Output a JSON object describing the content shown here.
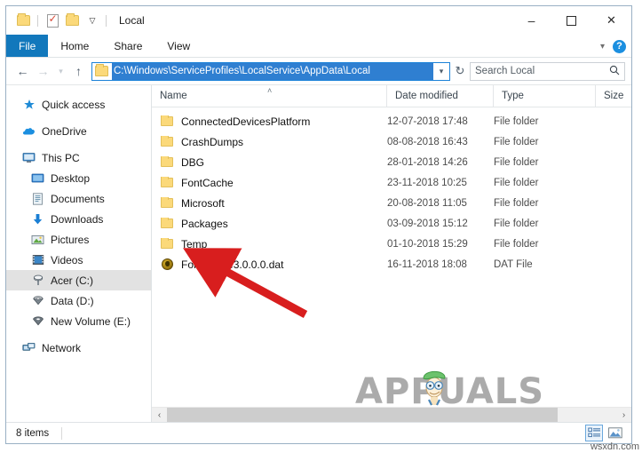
{
  "window": {
    "title": "Local",
    "quick_access": [
      "folder-icon",
      "properties-icon",
      "new-folder-icon",
      "customize-dropdown"
    ],
    "controls": {
      "minimize": "–",
      "maximize": "□",
      "close": "✕"
    }
  },
  "ribbon": {
    "tabs": [
      {
        "label": "File",
        "active": true
      },
      {
        "label": "Home",
        "active": false
      },
      {
        "label": "Share",
        "active": false
      },
      {
        "label": "View",
        "active": false
      }
    ],
    "collapse_icon": "chevron-down-icon",
    "help_icon": "?",
    "accent_color": "#1278bc"
  },
  "addressbar": {
    "back": "←",
    "forward": "→",
    "recent": "⌄",
    "up": "↑",
    "path": "C:\\Windows\\ServiceProfiles\\LocalService\\AppData\\Local",
    "dropdown": "⌄",
    "refresh": "↻",
    "selection_color": "#2f7fd1"
  },
  "search": {
    "placeholder": "Search Local",
    "icon": "search-icon"
  },
  "sidebar": {
    "items": [
      {
        "label": "Quick access",
        "icon": "star-icon",
        "indent": false,
        "gap": false,
        "selected": false
      },
      {
        "label": "OneDrive",
        "icon": "cloud-icon",
        "indent": false,
        "gap": true,
        "selected": false
      },
      {
        "label": "This PC",
        "icon": "monitor-icon",
        "indent": false,
        "gap": true,
        "selected": false
      },
      {
        "label": "Desktop",
        "icon": "desktop-icon",
        "indent": true,
        "gap": false,
        "selected": false
      },
      {
        "label": "Documents",
        "icon": "documents-icon",
        "indent": true,
        "gap": false,
        "selected": false
      },
      {
        "label": "Downloads",
        "icon": "download-icon",
        "indent": true,
        "gap": false,
        "selected": false
      },
      {
        "label": "Pictures",
        "icon": "pictures-icon",
        "indent": true,
        "gap": false,
        "selected": false
      },
      {
        "label": "Videos",
        "icon": "videos-icon",
        "indent": true,
        "gap": false,
        "selected": false
      },
      {
        "label": "Acer (C:)",
        "icon": "drive-icon",
        "indent": true,
        "gap": false,
        "selected": true
      },
      {
        "label": "Data (D:)",
        "icon": "drive-icon",
        "indent": true,
        "gap": false,
        "selected": false
      },
      {
        "label": "New Volume (E:)",
        "icon": "drive-icon",
        "indent": true,
        "gap": false,
        "selected": false
      },
      {
        "label": "Network",
        "icon": "network-icon",
        "indent": false,
        "gap": true,
        "selected": false
      }
    ]
  },
  "filelist": {
    "columns": [
      {
        "label": "Name",
        "key": "name"
      },
      {
        "label": "Date modified",
        "key": "date"
      },
      {
        "label": "Type",
        "key": "type"
      },
      {
        "label": "Size",
        "key": "size"
      }
    ],
    "sort_column": "Name",
    "sort_caret": "˄",
    "rows": [
      {
        "name": "ConnectedDevicesPlatform",
        "date": "12-07-2018 17:48",
        "type": "File folder",
        "size": "",
        "icon": "folder-icon"
      },
      {
        "name": "CrashDumps",
        "date": "08-08-2018 16:43",
        "type": "File folder",
        "size": "",
        "icon": "folder-icon"
      },
      {
        "name": "DBG",
        "date": "28-01-2018 14:26",
        "type": "File folder",
        "size": "",
        "icon": "folder-icon"
      },
      {
        "name": "FontCache",
        "date": "23-11-2018 10:25",
        "type": "File folder",
        "size": "",
        "icon": "folder-icon"
      },
      {
        "name": "Microsoft",
        "date": "20-08-2018 11:05",
        "type": "File folder",
        "size": "",
        "icon": "folder-icon"
      },
      {
        "name": "Packages",
        "date": "03-09-2018 15:12",
        "type": "File folder",
        "size": "",
        "icon": "folder-icon"
      },
      {
        "name": "Temp",
        "date": "01-10-2018 15:29",
        "type": "File folder",
        "size": "",
        "icon": "folder-icon"
      },
      {
        "name": "FontCache3.0.0.0.dat",
        "date": "16-11-2018 18:08",
        "type": "DAT File",
        "size": "",
        "icon": "dat-file-icon"
      }
    ]
  },
  "scrollbar": {
    "left_arrow": "‹",
    "right_arrow": "›"
  },
  "statusbar": {
    "item_count": "8 items",
    "view_details_icon": "details-view-icon",
    "view_large_icons_icon": "large-icons-view-icon"
  },
  "annotations": {
    "arrow_color": "#d81e1e",
    "watermark_text": "APPUALS",
    "corner_watermark": "wsxdn.com"
  }
}
